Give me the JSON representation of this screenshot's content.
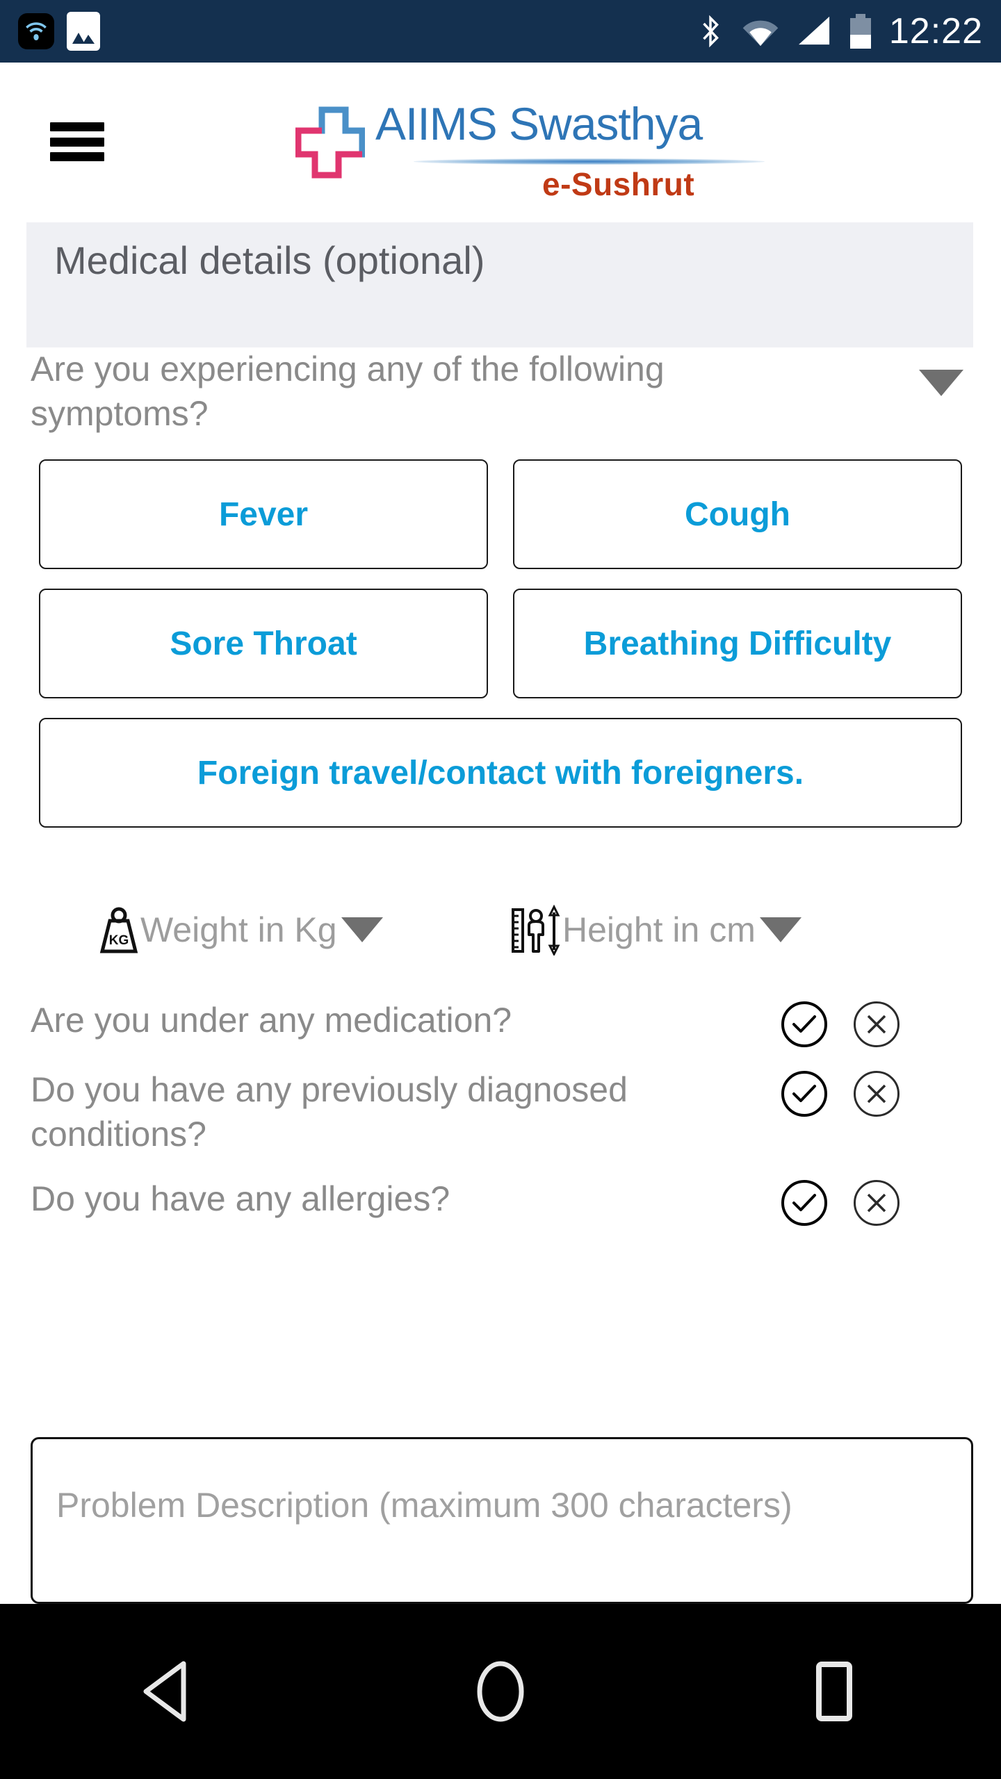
{
  "status_bar": {
    "time": "12:22",
    "icons": [
      "wifi-notification-icon",
      "photo-icon",
      "bluetooth-icon",
      "wifi-icon",
      "signal-icon",
      "battery-icon"
    ],
    "background_color": "#14304f"
  },
  "app_header": {
    "menu_icon": "hamburger-menu-icon",
    "logo_icon": "medical-cross-logo-icon",
    "title": "AIIMS Swasthya",
    "subtitle": "e-Sushrut",
    "title_color": "#2e75b6",
    "subtitle_color": "#c03a15",
    "logo_cross_blue": "#4a90c8",
    "logo_cross_pink": "#e0356f"
  },
  "section": {
    "title": "Medical details (optional)",
    "background_color": "#eff0f4"
  },
  "symptoms": {
    "question": "Are you experiencing any of the following symptoms?",
    "dropdown_icon": "chevron-down-icon",
    "button_text_color": "#0b9cd8",
    "options": [
      {
        "label": "Fever"
      },
      {
        "label": "Cough"
      },
      {
        "label": "Sore Throat"
      },
      {
        "label": "Breathing Difficulty"
      },
      {
        "label": "Foreign travel/contact with foreigners."
      }
    ]
  },
  "measurements": [
    {
      "icon": "weight-kg-icon",
      "placeholder": "Weight in Kg",
      "value": "",
      "dropdown_icon": "chevron-down-icon"
    },
    {
      "icon": "height-ruler-icon",
      "placeholder": "Height in cm",
      "value": "",
      "dropdown_icon": "chevron-down-icon"
    }
  ],
  "yes_no_questions": [
    {
      "text": "Are you under any medication?",
      "yes_icon": "check-circle-icon",
      "no_icon": "x-circle-icon"
    },
    {
      "text": "Do you have any previously diagnosed conditions?",
      "yes_icon": "check-circle-icon",
      "no_icon": "x-circle-icon"
    },
    {
      "text": "Do you have any allergies?",
      "yes_icon": "check-circle-icon",
      "no_icon": "x-circle-icon"
    }
  ],
  "problem_description": {
    "placeholder": "Problem Description (maximum 300 characters)",
    "value": ""
  },
  "navigation_bar": {
    "back_icon": "back-triangle-icon",
    "home_icon": "home-circle-icon",
    "recents_icon": "recents-square-icon",
    "background_color": "#000000"
  }
}
